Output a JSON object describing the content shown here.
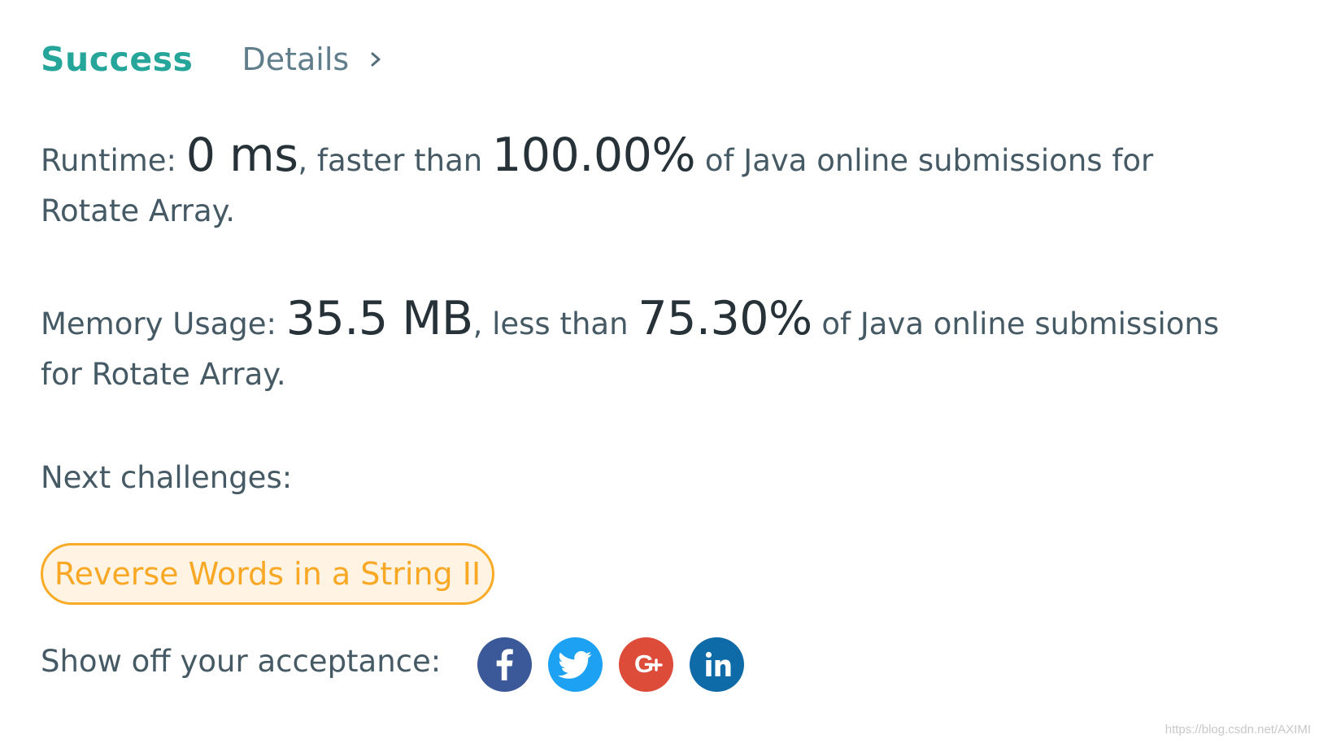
{
  "header": {
    "status": "Success",
    "details_label": "Details"
  },
  "runtime": {
    "label": "Runtime: ",
    "value": "0 ms",
    "mid_text": ", faster than ",
    "percent": "100.00%",
    "suffix": " of Java online submissions for Rotate Array."
  },
  "memory": {
    "label": "Memory Usage: ",
    "value": "35.5 MB",
    "mid_text": ", less than ",
    "percent": "75.30%",
    "suffix": " of Java online submissions for Rotate Array."
  },
  "next": {
    "label": "Next challenges:",
    "challenges": [
      "Reverse Words in a String II"
    ]
  },
  "share": {
    "label": "Show off your acceptance:",
    "buttons": [
      {
        "name": "facebook",
        "icon": "facebook-icon",
        "color": "#3b5998"
      },
      {
        "name": "twitter",
        "icon": "twitter-icon",
        "color": "#1da1f2"
      },
      {
        "name": "google-plus",
        "icon": "google-plus-icon",
        "color": "#dd4b39"
      },
      {
        "name": "linkedin",
        "icon": "linkedin-icon",
        "color": "#0e6ba8"
      }
    ]
  },
  "colors": {
    "success": "#26a69a",
    "challenge_border": "#f9ab25",
    "challenge_bg": "#fff4e3"
  },
  "watermark": "https://blog.csdn.net/AXIMI"
}
